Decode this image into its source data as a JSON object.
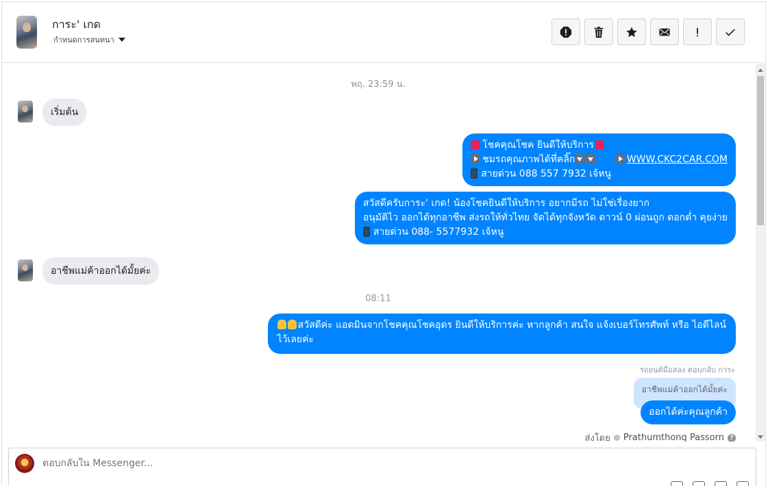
{
  "header": {
    "contact_name": "การะ' เกด",
    "assign_label": "กำหนดการสนทนา",
    "toolbar": [
      {
        "name": "report-spam-icon",
        "label": "Report"
      },
      {
        "name": "trash-icon",
        "label": "Delete"
      },
      {
        "name": "star-icon",
        "label": "Star"
      },
      {
        "name": "envelope-icon",
        "label": "Mark unread"
      },
      {
        "name": "exclamation-icon",
        "label": "Follow up"
      },
      {
        "name": "checkmark-icon",
        "label": "Done"
      }
    ]
  },
  "thread": {
    "timestamp_1": "พฤ. 23:59 น.",
    "msg_in_1": "เริ่มต้น",
    "msg_out_1": {
      "line1": "โชคคุณโชค ยินดีให้บริการ",
      "line2_a": "ชมรถคุณภาพได้ที่คลิ๊ก",
      "line2_link": "WWW.CKC2CAR.COM",
      "line3": "สายด่วน 088 557 7932 เจ้หนู"
    },
    "msg_out_2": {
      "line1": "สวัสดีครับการะ' เกด! น้องโชคยินดีให้บริการ อยากมีรถ ไม่ใช่เรื่องยาก",
      "line2": "อนุมัติไว ออกได้ทุกอาชีพ ส่งรถให้ทั่วไทย จัดได้ทุกจังหวัด ดาวน์ 0  ผ่อนถูก ดอกต่ำ คุยง่าย",
      "line3": "สายด่วน 088- 5577932 เจ้หนู"
    },
    "msg_in_2": "อาชีพแม่ค้าออกได้มั้ยค่ะ",
    "timestamp_2": "08:11",
    "msg_out_3": {
      "line1": "สวัสดีค่ะ แอดมินจากโชคคุณโชคอุดร ยินดีให้บริการค่ะ หากลูกค้า สนใจ แจ้งเบอร์โทรศัพท์ หรือ ไอดีไลน์",
      "line2": "ไว้เลยค่ะ"
    },
    "reply_note": "รถยนต์มือสอง ตอบกลับ การะ",
    "quoted_text": "อาชีพแม่ค้าออกได้มั้ยค่ะ",
    "msg_out_4": "ออกได้ค่ะคุณลูกค้า",
    "sent_by_label": "ส่งโดย",
    "sender_name": "Prathumthong Passorn"
  },
  "composer": {
    "placeholder": "ตอบกลับใน Messenger..."
  }
}
